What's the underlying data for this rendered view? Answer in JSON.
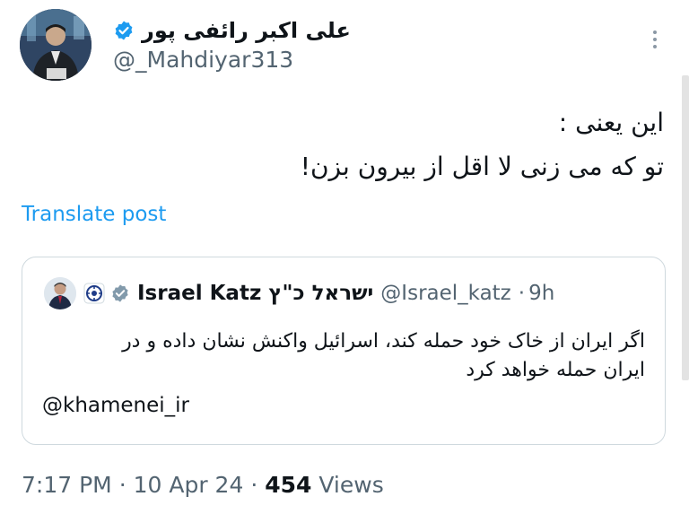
{
  "author": {
    "display_name": "علی اکبر رائفی پور",
    "handle": "@_Mahdiyar313",
    "verified": true
  },
  "tweet": {
    "lines": [
      "این یعنی :",
      "تو که می زنی لا اقل از بیرون بزن!"
    ],
    "translate_label": "Translate post"
  },
  "quoted": {
    "name_latin": "Israel Katz",
    "name_hebrew": "ישראל כ\"ץ",
    "handle": "@Israel_katz",
    "separator": "·",
    "age": "9h",
    "lines": [
      "اگر ایران از خاک خود حمله کند، اسرائیل واکنش نشان داده و در",
      "ایران حمله خواهد کرد"
    ],
    "mention": "@khamenei_ir"
  },
  "meta": {
    "time": "7:17 PM",
    "dot1": "·",
    "date": "10 Apr 24",
    "dot2": "·",
    "views_count": "454",
    "views_label": "Views"
  },
  "colors": {
    "verified_blue": "#1d9bf0",
    "link": "#1d9bf0",
    "muted": "#536471",
    "border": "#cfd9de"
  },
  "icons": {
    "verified": "verified-badge-icon",
    "more": "more-options-icon",
    "affiliate": "government-affiliation-badge-icon"
  }
}
